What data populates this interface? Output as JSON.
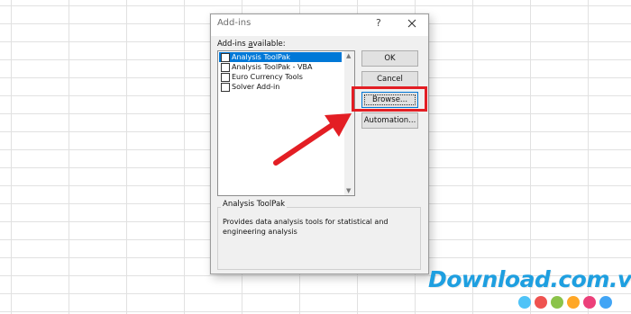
{
  "dialog": {
    "title": "Add-ins",
    "help": "?",
    "available_label_prefix": "Add-ins ",
    "available_label_underlined": "a",
    "available_label_suffix": "vailable:",
    "items": [
      {
        "label": "Analysis ToolPak",
        "checked": false,
        "selected": true
      },
      {
        "label": "Analysis ToolPak - VBA",
        "checked": false,
        "selected": false
      },
      {
        "label": "Euro Currency Tools",
        "checked": false,
        "selected": false
      },
      {
        "label": "Solver Add-in",
        "checked": false,
        "selected": false
      }
    ],
    "buttons": {
      "ok": "OK",
      "cancel": "Cancel",
      "browse": "Browse...",
      "automation": "Automation..."
    },
    "description": {
      "title": "Analysis ToolPak",
      "text": "Provides data analysis tools for statistical and engineering analysis"
    }
  },
  "watermark": {
    "text": "Download.com.vn",
    "dot_colors": [
      "#4fc3f7",
      "#ef5350",
      "#8bc34a",
      "#ffa726",
      "#ec407a",
      "#42a5f5"
    ]
  },
  "colors": {
    "highlight": "#e31e24",
    "selection": "#0078d7"
  }
}
